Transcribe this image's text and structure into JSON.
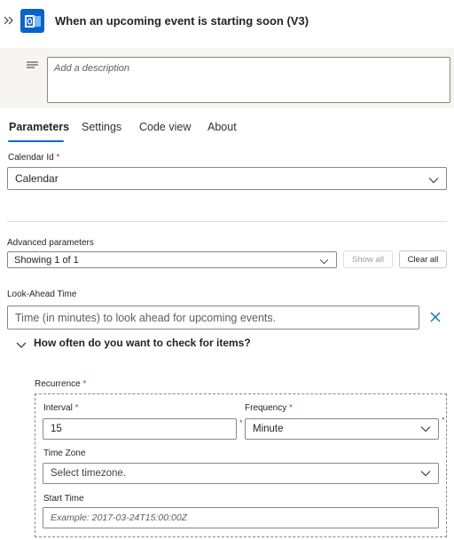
{
  "header": {
    "title": "When an upcoming event is starting soon (V3)"
  },
  "description": {
    "placeholder": "Add a description"
  },
  "tabs": [
    {
      "label": "Parameters",
      "active": true
    },
    {
      "label": "Settings",
      "active": false
    },
    {
      "label": "Code view",
      "active": false
    },
    {
      "label": "About",
      "active": false
    }
  ],
  "calendar": {
    "label": "Calendar Id",
    "required_mark": "*",
    "value": "Calendar"
  },
  "advanced": {
    "label": "Advanced parameters",
    "value": "Showing 1 of 1",
    "show_all_label": "Show all",
    "clear_all_label": "Clear all"
  },
  "look_ahead": {
    "label": "Look-Ahead Time",
    "placeholder": "Time (in minutes) to look ahead for upcoming events."
  },
  "check_section": {
    "label": "How often do you want to check for items?"
  },
  "recurrence": {
    "label": "Recurrence",
    "required_mark": "*",
    "interval": {
      "label": "Interval",
      "required_mark": "*",
      "value": "15"
    },
    "frequency": {
      "label": "Frequency",
      "required_mark": "*",
      "value": "Minute"
    },
    "time_zone": {
      "label": "Time Zone",
      "placeholder": "Select timezone."
    },
    "start_time": {
      "label": "Start Time",
      "placeholder": "Example: 2017-03-24T15:00:00Z"
    }
  },
  "colors": {
    "accent": "#0f6cbd",
    "app_icon": "#0a64c8",
    "required": "#c4314b"
  }
}
